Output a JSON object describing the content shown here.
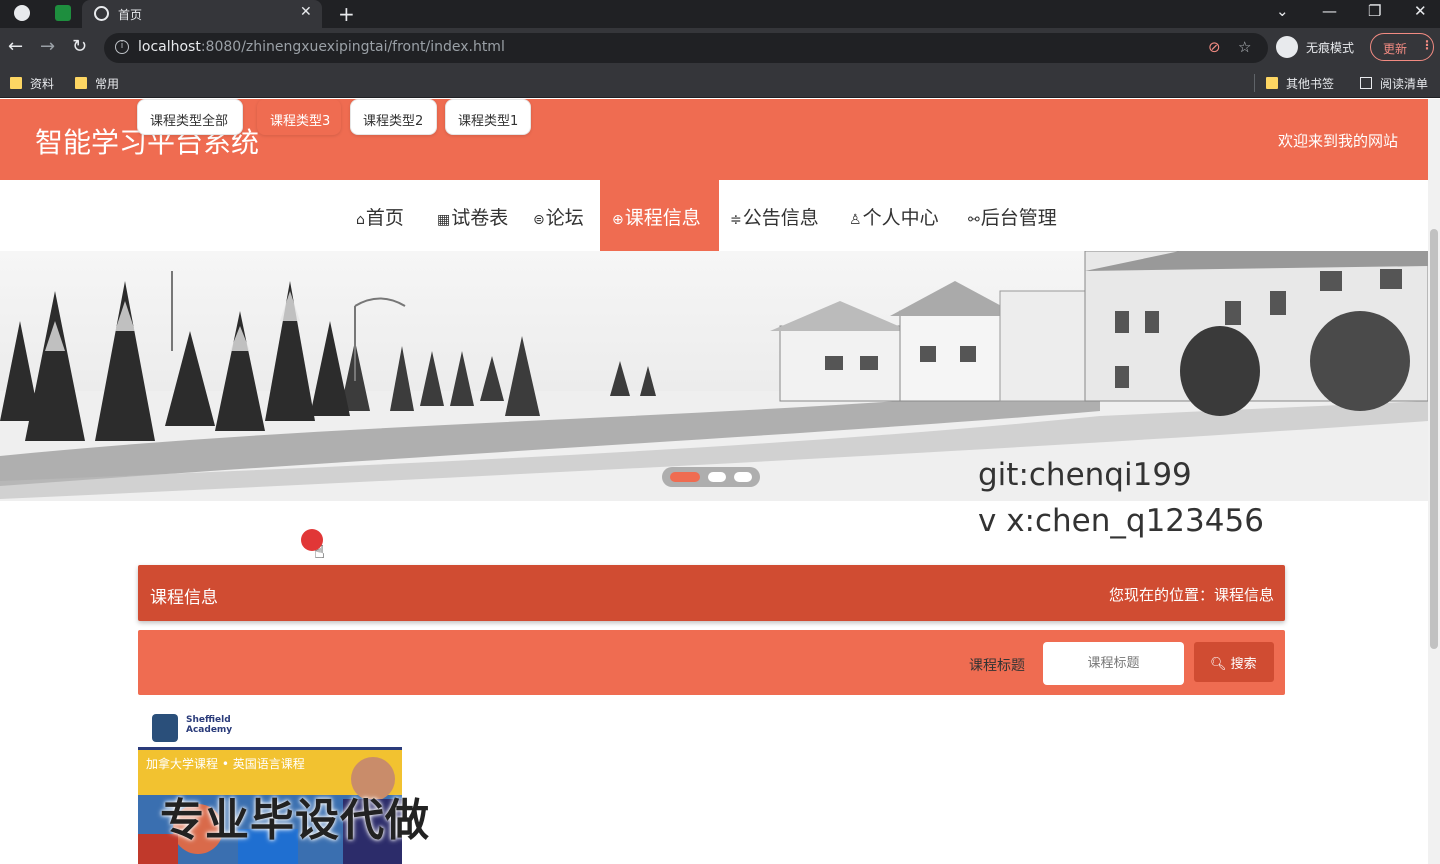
{
  "browser": {
    "tab_title": "首页",
    "url_host": "localhost",
    "url_rest": ":8080/zhinengxuexipingtai/front/index.html",
    "incognito_label": "无痕模式",
    "update_label": "更新",
    "bookmarks": [
      "资料",
      "常用"
    ],
    "bookmarks_right": [
      "其他书签",
      "阅读清单"
    ]
  },
  "header": {
    "site_title": "智能学习平台系统",
    "welcome": "欢迎来到我的网站"
  },
  "nav": [
    {
      "icon": "⌂",
      "label": "首页"
    },
    {
      "icon": "▦",
      "label": "试卷表"
    },
    {
      "icon": "⊜",
      "label": "论坛"
    },
    {
      "icon": "⊕",
      "label": "课程信息"
    },
    {
      "icon": "≑",
      "label": "公告信息"
    },
    {
      "icon": "♙",
      "label": "个人中心"
    },
    {
      "icon": "⚯",
      "label": "后台管理"
    }
  ],
  "watermark": {
    "line1": "git:chenqi199",
    "line2": "v x:chen_q123456"
  },
  "filters": [
    "课程类型全部",
    "课程类型3",
    "课程类型2",
    "课程类型1"
  ],
  "section": {
    "title": "课程信息",
    "breadcrumb": "您现在的位置：课程信息"
  },
  "search": {
    "label": "课程标题",
    "placeholder": "课程标题",
    "button": "搜索"
  },
  "card": {
    "logo_text": "Sheffield Academy",
    "banner_text": "加拿大学课程 • 英国语言课程",
    "overlay_text": "专业毕设代做"
  },
  "colors": {
    "accent": "#ef6c51",
    "accent_dark": "#d04c32"
  }
}
